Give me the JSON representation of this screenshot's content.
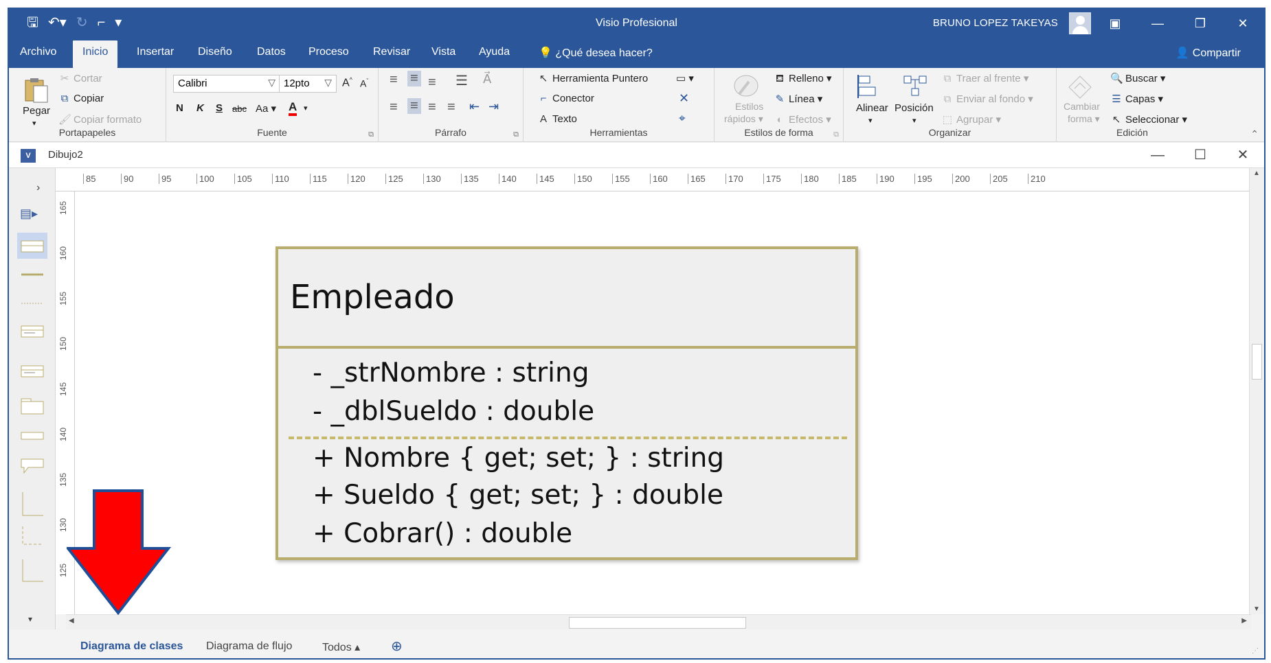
{
  "window": {
    "title": "Visio Profesional",
    "user": "BRUNO LOPEZ TAKEYAS",
    "buttons": [
      "ribbon-display",
      "minimize",
      "restore",
      "close"
    ]
  },
  "tabs": {
    "items": [
      "Archivo",
      "Inicio",
      "Insertar",
      "Diseño",
      "Datos",
      "Proceso",
      "Revisar",
      "Vista",
      "Ayuda"
    ],
    "active": "Inicio",
    "tell_me": "¿Qué desea hacer?",
    "share": "Compartir"
  },
  "ribbon": {
    "portapapeles": {
      "label": "Portapapeles",
      "paste": "Pegar",
      "cut": "Cortar",
      "copy": "Copiar",
      "format_painter": "Copiar formato"
    },
    "fuente": {
      "label": "Fuente",
      "font": "Calibri",
      "size": "12pto",
      "bold": "N",
      "italic": "K",
      "underline": "S",
      "strike": "abc",
      "case": "Aa"
    },
    "parrafo": {
      "label": "Párrafo"
    },
    "herramientas": {
      "label": "Herramientas",
      "pointer": "Herramienta Puntero",
      "connector": "Conector",
      "text": "Texto"
    },
    "estilos": {
      "label": "Estilos de forma",
      "quick_styles_1": "Estilos",
      "quick_styles_2": "rápidos",
      "fill": "Relleno",
      "line": "Línea",
      "effects": "Efectos"
    },
    "organizar": {
      "label": "Organizar",
      "align": "Alinear",
      "position": "Posición",
      "bring_front": "Traer al frente",
      "send_back": "Enviar al fondo",
      "group": "Agrupar"
    },
    "edicion": {
      "label": "Edición",
      "change_shape_1": "Cambiar",
      "change_shape_2": "forma",
      "find": "Buscar",
      "layers": "Capas",
      "select": "Seleccionar"
    }
  },
  "document": {
    "name": "Dibujo2"
  },
  "rulers": {
    "horizontal": [
      "85",
      "90",
      "95",
      "100",
      "105",
      "110",
      "115",
      "120",
      "125",
      "130",
      "135",
      "140",
      "145",
      "150",
      "155",
      "160",
      "165",
      "170",
      "175",
      "180",
      "185",
      "190",
      "195",
      "200",
      "205",
      "210"
    ],
    "vertical": [
      "165",
      "160",
      "155",
      "150",
      "145",
      "140",
      "135",
      "130",
      "125"
    ]
  },
  "uml_class": {
    "name": "Empleado",
    "attributes": [
      "- _strNombre : string",
      "- _dblSueldo : double"
    ],
    "operations": [
      "+ Nombre { get; set; } : string",
      "+ Sueldo { get; set; } : double",
      "+ Cobrar() : double"
    ]
  },
  "page_tabs": {
    "items": [
      "Diagrama de clases",
      "Diagrama de flujo",
      "Todos ▴"
    ],
    "active": "Diagrama de clases"
  },
  "colors": {
    "accent": "#2b579a",
    "uml_border": "#b8ad6c",
    "arrow_fill": "#ff0000",
    "arrow_stroke": "#1f4e99"
  }
}
